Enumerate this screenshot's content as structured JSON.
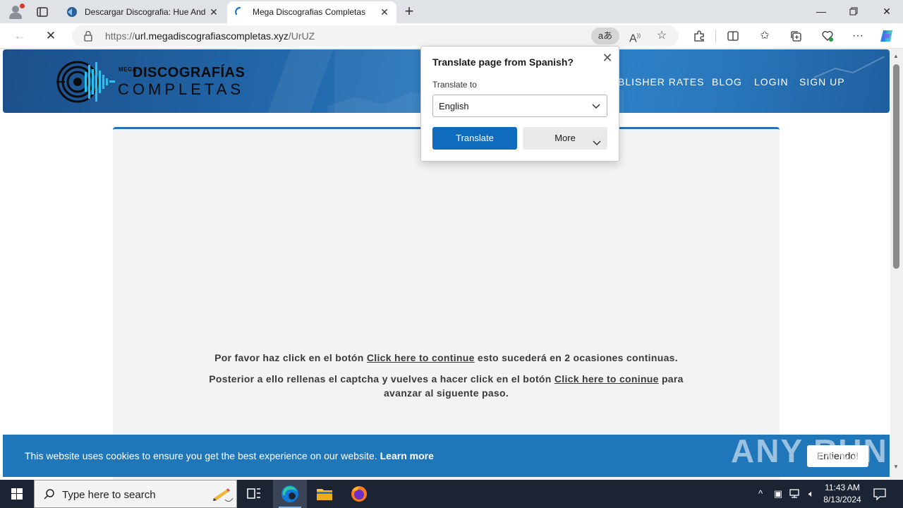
{
  "browser": {
    "tabs": [
      {
        "title": "Descargar Discografia: Hue And Cry",
        "active": false
      },
      {
        "title": "Mega Discografias Completas",
        "active": true
      }
    ],
    "address": {
      "scheme": "https://",
      "host": "url.megadiscografiascompletas.xyz",
      "path": "/UrUZ"
    },
    "translate_chip": "aあ"
  },
  "site": {
    "logo": {
      "mega": "MEGA",
      "line1": "DISCOGRAFÍAS",
      "line2": "COMPLETAS"
    },
    "nav": [
      "BLISHER RATES",
      "BLOG",
      "LOGIN",
      "SIGN UP"
    ],
    "instructions": {
      "p1_before": "Por favor haz click en el botón",
      "p1_link": "Click here to continue",
      "p1_after": "esto sucederá en 2 ocasiones continuas.",
      "p2_before": "Posterior a ello rellenas el captcha y vuelves a hacer click en el botón",
      "p2_link": "Click here to coninue",
      "p2_after": "para",
      "p2_line2": "avanzar al siguente paso."
    },
    "cookie": {
      "message": "This website uses cookies to ensure you get the best experience on our website.",
      "link": "Learn more",
      "button": "Entiendo!"
    },
    "watermark": "ANY RUN"
  },
  "translate_popup": {
    "title": "Translate page from Spanish?",
    "label": "Translate to",
    "selected_language": "English",
    "primary_button": "Translate",
    "secondary_button": "More"
  },
  "taskbar": {
    "search_placeholder": "Type here to search",
    "time": "11:43 AM",
    "date": "8/13/2024"
  },
  "colors": {
    "accent": "#0f6cbd",
    "hero_blue": "#236aae",
    "cookie_bar": "#1f76b8",
    "card_border": "#2a6fb5",
    "taskbar": "#1c2433"
  }
}
